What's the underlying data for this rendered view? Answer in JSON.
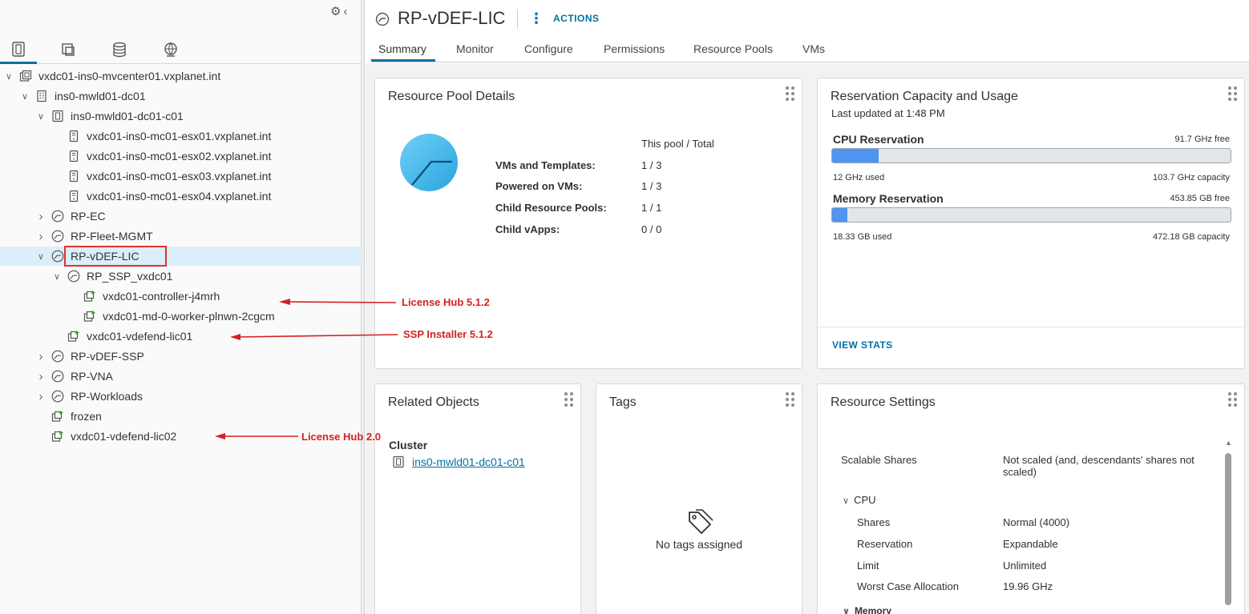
{
  "navigator": {
    "tabs": [
      {
        "icon": "hosts-and-clusters-icon",
        "active": true
      },
      {
        "icon": "vms-and-templates-icon",
        "active": false
      },
      {
        "icon": "storage-icon",
        "active": false
      },
      {
        "icon": "networking-icon",
        "active": false
      }
    ],
    "tree": [
      {
        "label": "vxdc01-ins0-mvcenter01.vxplanet.int",
        "level": 0,
        "expander": "open",
        "icon": "vcenter-icon"
      },
      {
        "label": "ins0-mwld01-dc01",
        "level": 1,
        "expander": "open",
        "icon": "datacenter-icon"
      },
      {
        "label": "ins0-mwld01-dc01-c01",
        "level": 2,
        "expander": "open",
        "icon": "cluster-icon"
      },
      {
        "label": "vxdc01-ins0-mc01-esx01.vxplanet.int",
        "level": 3,
        "expander": "none",
        "icon": "host-icon"
      },
      {
        "label": "vxdc01-ins0-mc01-esx02.vxplanet.int",
        "level": 3,
        "expander": "none",
        "icon": "host-icon"
      },
      {
        "label": "vxdc01-ins0-mc01-esx03.vxplanet.int",
        "level": 3,
        "expander": "none",
        "icon": "host-icon"
      },
      {
        "label": "vxdc01-ins0-mc01-esx04.vxplanet.int",
        "level": 3,
        "expander": "none",
        "icon": "host-icon"
      },
      {
        "label": "RP-EC",
        "level": 2,
        "expander": "closed",
        "icon": "resource-pool-icon"
      },
      {
        "label": "RP-Fleet-MGMT",
        "level": 2,
        "expander": "closed",
        "icon": "resource-pool-icon"
      },
      {
        "label": "RP-vDEF-LIC",
        "level": 2,
        "expander": "open",
        "icon": "resource-pool-icon",
        "selected": true
      },
      {
        "label": "RP_SSP_vxdc01",
        "level": 3,
        "expander": "open",
        "icon": "resource-pool-icon"
      },
      {
        "label": "vxdc01-controller-j4mrh",
        "level": 4,
        "expander": "none",
        "icon": "vm-icon"
      },
      {
        "label": "vxdc01-md-0-worker-plnwn-2cgcm",
        "level": 4,
        "expander": "none",
        "icon": "vm-icon"
      },
      {
        "label": "vxdc01-vdefend-lic01",
        "level": 3,
        "expander": "none",
        "icon": "vm-icon"
      },
      {
        "label": "RP-vDEF-SSP",
        "level": 2,
        "expander": "closed",
        "icon": "resource-pool-icon"
      },
      {
        "label": "RP-VNA",
        "level": 2,
        "expander": "closed",
        "icon": "resource-pool-icon"
      },
      {
        "label": "RP-Workloads",
        "level": 2,
        "expander": "closed",
        "icon": "resource-pool-icon"
      },
      {
        "label": "frozen",
        "level": 2,
        "expander": "none",
        "icon": "vm-icon"
      },
      {
        "label": "vxdc01-vdefend-lic02",
        "level": 2,
        "expander": "none",
        "icon": "vm-icon"
      }
    ]
  },
  "annotations": [
    {
      "text": "License Hub 5.1.2"
    },
    {
      "text": "SSP Installer 5.1.2"
    },
    {
      "text": "License Hub 2.0"
    }
  ],
  "header": {
    "title": "RP-vDEF-LIC",
    "actions_label": "ACTIONS",
    "tabs": [
      "Summary",
      "Monitor",
      "Configure",
      "Permissions",
      "Resource Pools",
      "VMs"
    ],
    "active_tab": "Summary"
  },
  "resource_pool_details": {
    "title": "Resource Pool Details",
    "column_header": "This pool / Total",
    "rows": [
      {
        "key": "VMs and Templates:",
        "value": "1 / 3"
      },
      {
        "key": "Powered on VMs:",
        "value": "1 / 3"
      },
      {
        "key": "Child Resource Pools:",
        "value": "1 / 1"
      },
      {
        "key": "Child vApps:",
        "value": "0 / 0"
      }
    ]
  },
  "reservation": {
    "title": "Reservation Capacity and Usage",
    "updated": "Last updated at 1:48 PM",
    "cpu": {
      "label": "CPU Reservation",
      "free": "91.7 GHz free",
      "used": "12 GHz used",
      "capacity": "103.7 GHz capacity",
      "fraction": 0.116
    },
    "memory": {
      "label": "Memory Reservation",
      "free": "453.85 GB free",
      "used": "18.33 GB used",
      "capacity": "472.18 GB capacity",
      "fraction": 0.039
    },
    "view_stats": "VIEW STATS"
  },
  "related_objects": {
    "title": "Related Objects",
    "section": "Cluster",
    "link": "ins0-mwld01-dc01-c01"
  },
  "tags": {
    "title": "Tags",
    "empty_text": "No tags assigned"
  },
  "resource_settings": {
    "title": "Resource Settings",
    "scalable_label": "Scalable Shares",
    "scalable_value": "Not scaled (and, descendants' shares not scaled)",
    "cpu_label": "CPU",
    "rows": [
      {
        "key": "Shares",
        "value": "Normal (4000)"
      },
      {
        "key": "Reservation",
        "value": "Expandable"
      },
      {
        "key": "Limit",
        "value": "Unlimited"
      },
      {
        "key": "Worst Case Allocation",
        "value": "19.96 GHz"
      }
    ],
    "memory_label": "Memory"
  },
  "colors": {
    "accent": "#0072a3",
    "bar_fill": "#4f94f0",
    "annotation": "#d42020",
    "selection": "#dbeefa"
  }
}
